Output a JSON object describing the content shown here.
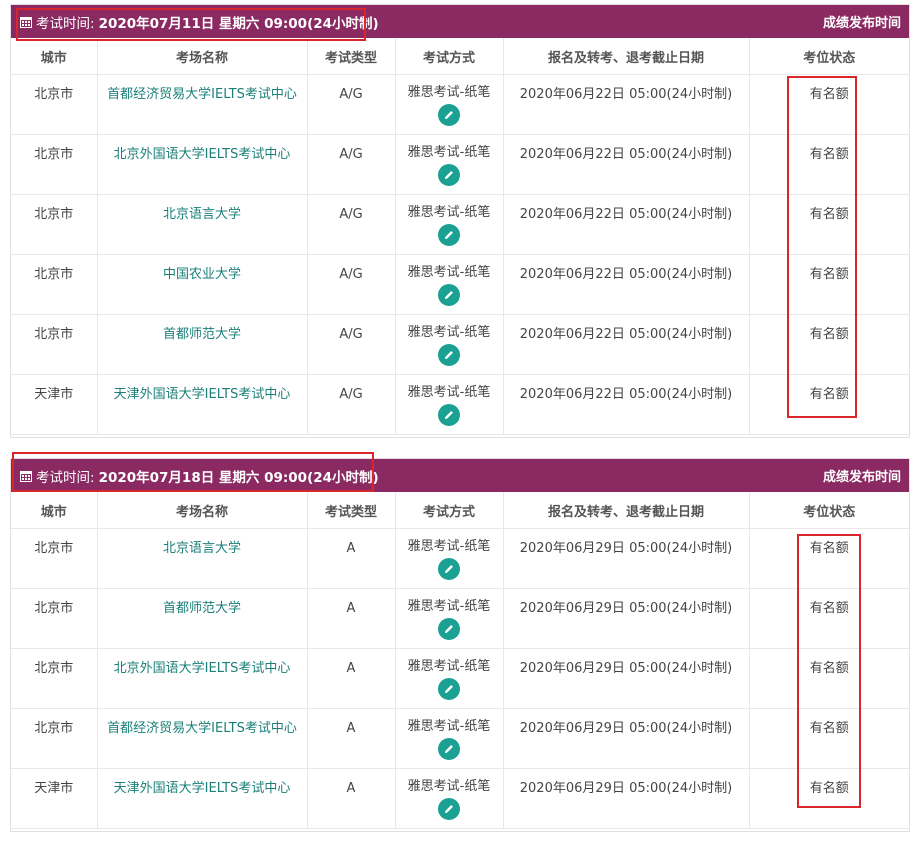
{
  "columns": [
    "城市",
    "考场名称",
    "考试类型",
    "考试方式",
    "报名及转考、退考截止日期",
    "考位状态"
  ],
  "sessions": [
    {
      "header_prefix": "考试时间:",
      "header_date": "2020年07月11日 星期六 09:00(24小时制)",
      "header_right": "成绩发布时间",
      "rows": [
        {
          "city": "北京市",
          "venue": "首都经济贸易大学IELTS考试中心",
          "type": "A/G",
          "method": "雅思考试-纸笔",
          "deadline": "2020年06月22日 05:00(24小时制)",
          "status": "有名额"
        },
        {
          "city": "北京市",
          "venue": "北京外国语大学IELTS考试中心",
          "type": "A/G",
          "method": "雅思考试-纸笔",
          "deadline": "2020年06月22日 05:00(24小时制)",
          "status": "有名额"
        },
        {
          "city": "北京市",
          "venue": "北京语言大学",
          "type": "A/G",
          "method": "雅思考试-纸笔",
          "deadline": "2020年06月22日 05:00(24小时制)",
          "status": "有名额"
        },
        {
          "city": "北京市",
          "venue": "中国农业大学",
          "type": "A/G",
          "method": "雅思考试-纸笔",
          "deadline": "2020年06月22日 05:00(24小时制)",
          "status": "有名额"
        },
        {
          "city": "北京市",
          "venue": "首都师范大学",
          "type": "A/G",
          "method": "雅思考试-纸笔",
          "deadline": "2020年06月22日 05:00(24小时制)",
          "status": "有名额"
        },
        {
          "city": "天津市",
          "venue": "天津外国语大学IELTS考试中心",
          "type": "A/G",
          "method": "雅思考试-纸笔",
          "deadline": "2020年06月22日 05:00(24小时制)",
          "status": "有名额"
        }
      ]
    },
    {
      "header_prefix": "考试时间:",
      "header_date": "2020年07月18日 星期六 09:00(24小时制)",
      "header_right": "成绩发布时间",
      "rows": [
        {
          "city": "北京市",
          "venue": "北京语言大学",
          "type": "A",
          "method": "雅思考试-纸笔",
          "deadline": "2020年06月29日 05:00(24小时制)",
          "status": "有名额"
        },
        {
          "city": "北京市",
          "venue": "首都师范大学",
          "type": "A",
          "method": "雅思考试-纸笔",
          "deadline": "2020年06月29日 05:00(24小时制)",
          "status": "有名额"
        },
        {
          "city": "北京市",
          "venue": "北京外国语大学IELTS考试中心",
          "type": "A",
          "method": "雅思考试-纸笔",
          "deadline": "2020年06月29日 05:00(24小时制)",
          "status": "有名额"
        },
        {
          "city": "北京市",
          "venue": "首都经济贸易大学IELTS考试中心",
          "type": "A",
          "method": "雅思考试-纸笔",
          "deadline": "2020年06月29日 05:00(24小时制)",
          "status": "有名额"
        },
        {
          "city": "天津市",
          "venue": "天津外国语大学IELTS考试中心",
          "type": "A",
          "method": "雅思考试-纸笔",
          "deadline": "2020年06月29日 05:00(24小时制)",
          "status": "有名额"
        }
      ]
    }
  ],
  "icons": {
    "header_icon": "calendar-icon",
    "method_icon": "pencil-icon"
  },
  "colors": {
    "header_bg": "#8b2a62",
    "venue_link": "#1a7f79",
    "edit_button": "#1aa193",
    "highlight_box": "#d8262b"
  }
}
